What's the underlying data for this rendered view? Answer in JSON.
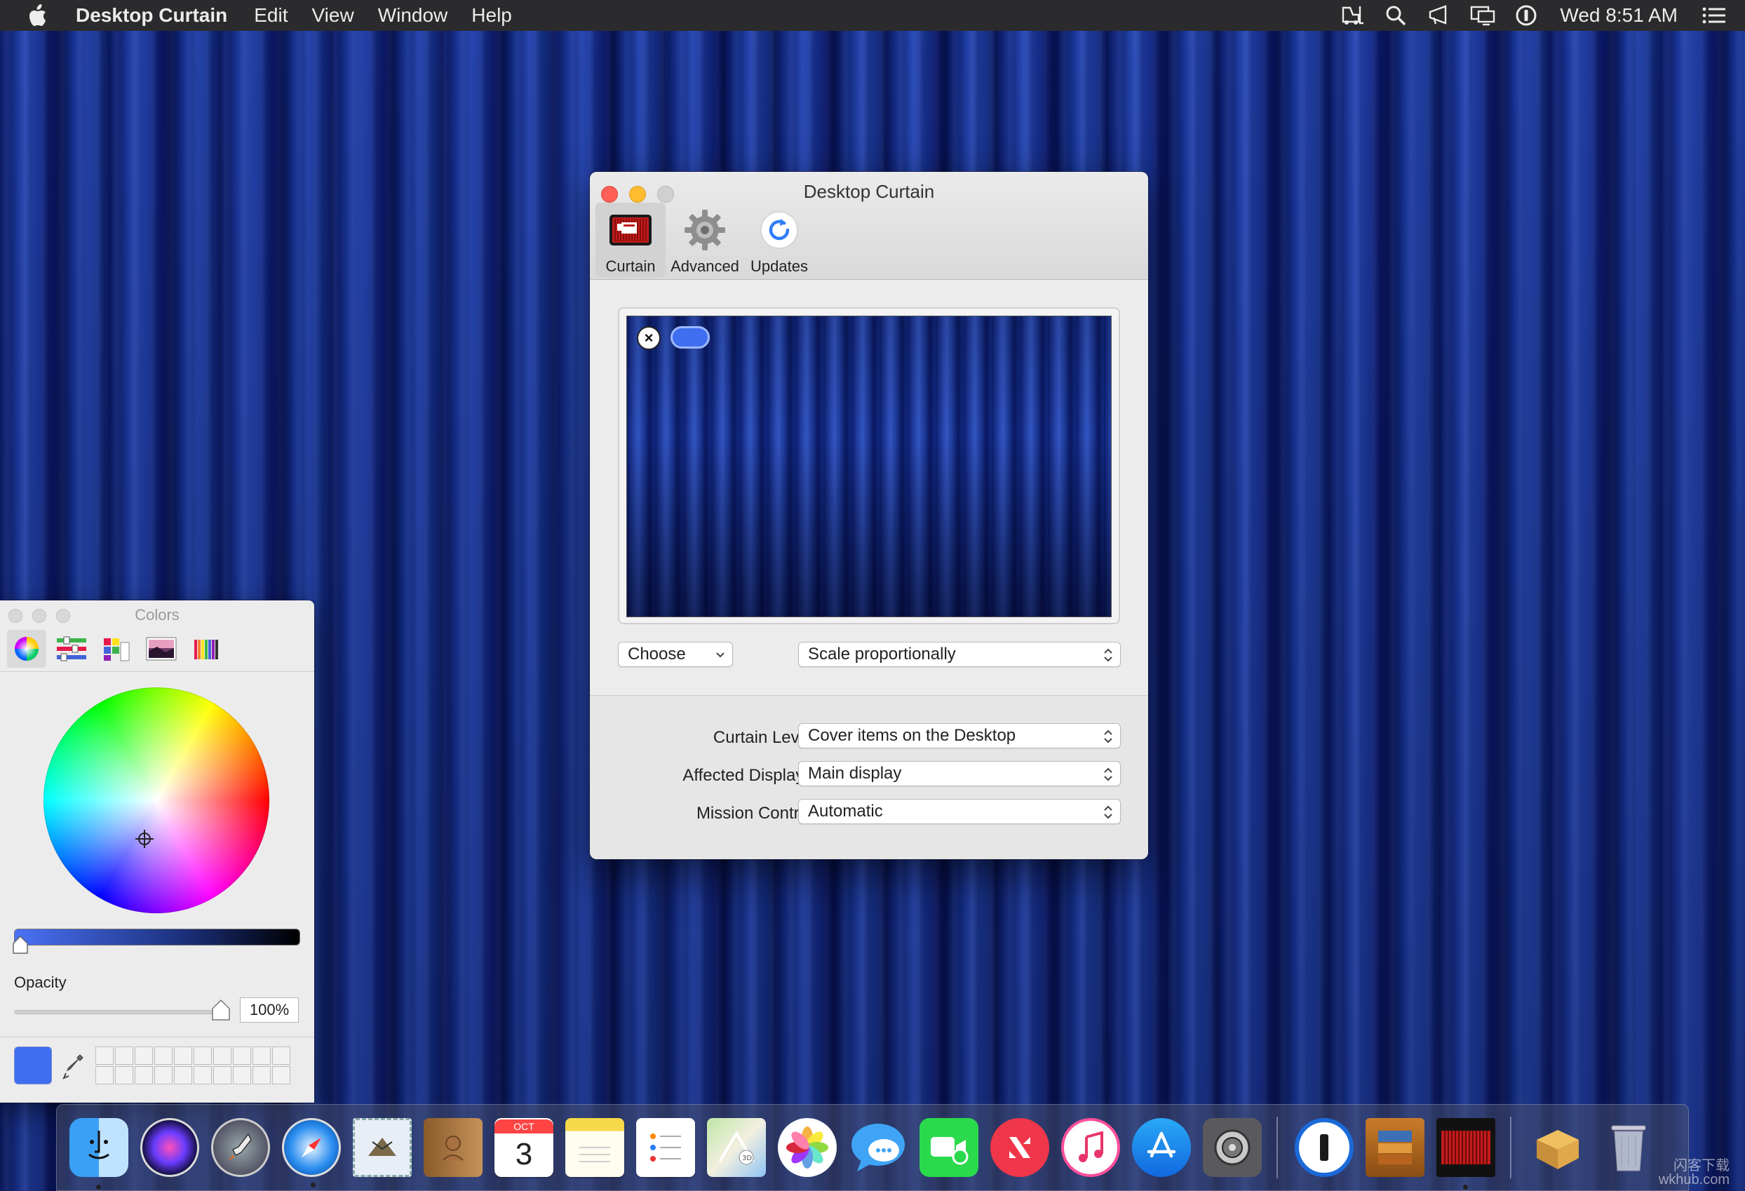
{
  "menubar": {
    "app_name": "Desktop Curtain",
    "menus": [
      "Edit",
      "View",
      "Window",
      "Help"
    ],
    "clock": "Wed 8:51 AM",
    "status_icons": [
      "forklift-icon",
      "search-icon",
      "megaphone-icon",
      "display-mirroring-icon",
      "onepassword-icon",
      "control-center-icon"
    ]
  },
  "window": {
    "title": "Desktop Curtain",
    "tabs": [
      {
        "label": "Curtain",
        "icon": "curtain-icon",
        "selected": true
      },
      {
        "label": "Advanced",
        "icon": "gear-icon",
        "selected": false
      },
      {
        "label": "Updates",
        "icon": "refresh-icon",
        "selected": false
      }
    ],
    "choose_label": "Choose",
    "scale_value": "Scale proportionally",
    "fields": [
      {
        "label": "Curtain Level:",
        "value": "Cover items on the Desktop"
      },
      {
        "label": "Affected Displays:",
        "value": "Main display"
      },
      {
        "label": "Mission Control:",
        "value": "Automatic"
      }
    ],
    "selected_color": "#3f6ef0"
  },
  "colors_panel": {
    "title": "Colors",
    "tabs": [
      "color-wheel-icon",
      "sliders-icon",
      "palettes-icon",
      "image-palette-icon",
      "pencils-icon"
    ],
    "opacity_label": "Opacity",
    "opacity_value": "100%",
    "opacity_fraction": 1.0,
    "current_color": "#3f6ef0"
  },
  "dock": {
    "apps": [
      {
        "name": "finder-icon",
        "running": true
      },
      {
        "name": "siri-icon",
        "running": false
      },
      {
        "name": "launchpad-icon",
        "running": false
      },
      {
        "name": "safari-icon",
        "running": true
      },
      {
        "name": "mail-icon",
        "running": false
      },
      {
        "name": "contacts-icon",
        "running": false
      },
      {
        "name": "calendar-icon",
        "running": false,
        "month": "OCT",
        "day": "3"
      },
      {
        "name": "notes-icon",
        "running": false
      },
      {
        "name": "reminders-icon",
        "running": false
      },
      {
        "name": "maps-icon",
        "running": false
      },
      {
        "name": "photos-icon",
        "running": false
      },
      {
        "name": "messages-icon",
        "running": false
      },
      {
        "name": "facetime-icon",
        "running": false
      },
      {
        "name": "news-icon",
        "running": false
      },
      {
        "name": "itunes-icon",
        "running": false
      },
      {
        "name": "app-store-icon",
        "running": false
      },
      {
        "name": "system-preferences-icon",
        "running": false
      },
      {
        "name": "onepassword-icon",
        "running": false
      },
      {
        "name": "archive-utility-icon",
        "running": false
      },
      {
        "name": "desktop-curtain-icon",
        "running": true
      },
      {
        "name": "installer-icon",
        "running": false
      },
      {
        "name": "trash-icon",
        "running": false
      }
    ]
  },
  "watermark": {
    "line1": "闪客下载",
    "line2": "wkhub.com"
  }
}
